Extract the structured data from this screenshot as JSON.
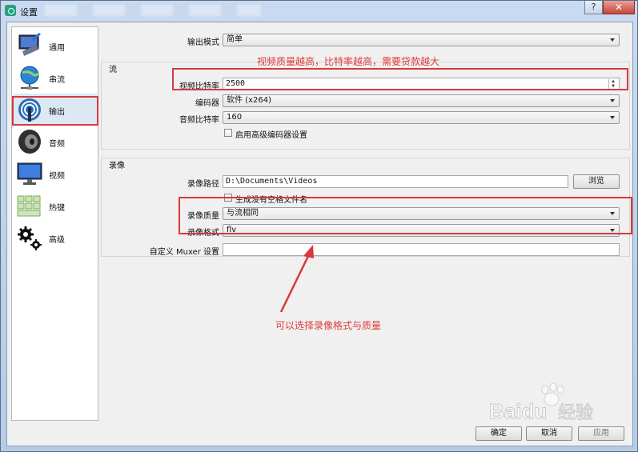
{
  "window": {
    "title": "设置",
    "help_label": "?",
    "close_label": "✕"
  },
  "sidebar": {
    "items": [
      {
        "label": "通用",
        "icon": "monitor-icon"
      },
      {
        "label": "串流",
        "icon": "globe-network-icon"
      },
      {
        "label": "输出",
        "icon": "broadcast-icon"
      },
      {
        "label": "音频",
        "icon": "speaker-icon"
      },
      {
        "label": "视频",
        "icon": "display-icon"
      },
      {
        "label": "热键",
        "icon": "keyboard-icon"
      },
      {
        "label": "高级",
        "icon": "gears-icon"
      }
    ],
    "selected": "输出"
  },
  "output": {
    "mode_label": "输出模式",
    "mode_value": "简单"
  },
  "stream": {
    "group_title": "流",
    "video_bitrate_label": "视频比特率",
    "video_bitrate_value": "2500",
    "encoder_label": "编码器",
    "encoder_value": "软件 (x264)",
    "audio_bitrate_label": "音频比特率",
    "audio_bitrate_value": "160",
    "advanced_encoder_label": "启用高级编码器设置"
  },
  "recording": {
    "group_title": "录像",
    "path_label": "录像路径",
    "path_value": "D:\\Documents\\Videos",
    "browse_label": "浏览",
    "no_space_label": "生成没有空格文件名",
    "quality_label": "录像质量",
    "quality_value": "与流相同",
    "format_label": "录像格式",
    "format_value": "flv",
    "muxer_label": "自定义 Muxer 设置",
    "muxer_value": ""
  },
  "footer": {
    "ok_label": "确定",
    "cancel_label": "取消",
    "apply_label": "应用"
  },
  "annotations": {
    "bitrate_note": "视频质量越高，比特率越高，需要贷款越大",
    "format_note": "可以选择录像格式与质量",
    "color": "#d8393a"
  },
  "watermark": {
    "text": "Baidu经验"
  }
}
